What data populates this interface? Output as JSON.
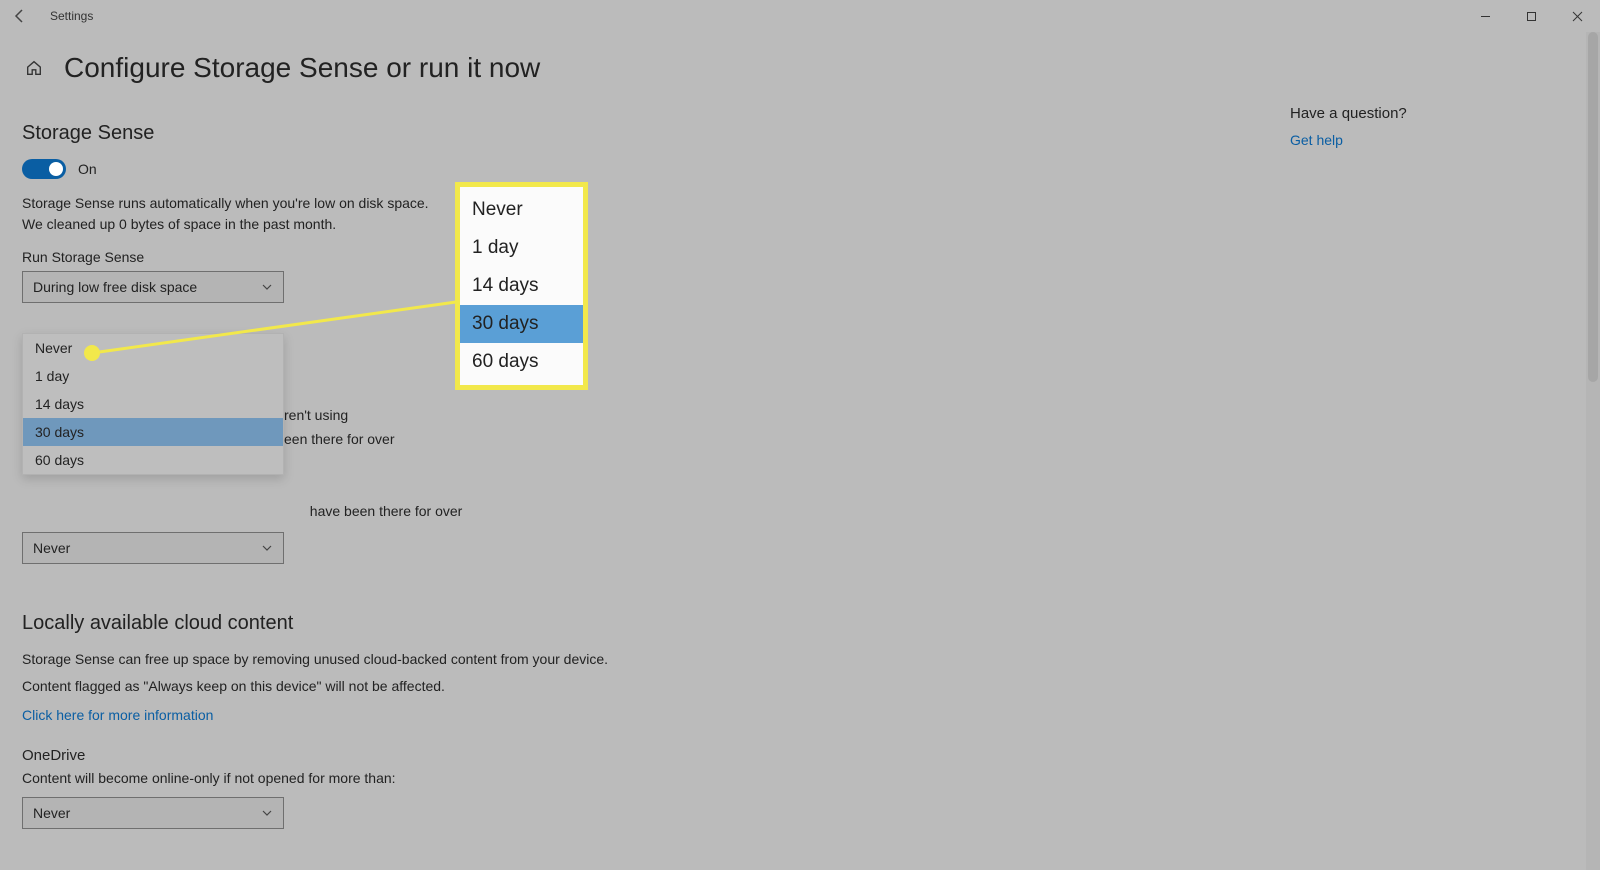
{
  "window": {
    "app_title": "Settings",
    "page_title": "Configure Storage Sense or run it now"
  },
  "storage_sense": {
    "heading": "Storage Sense",
    "toggle_state_label": "On",
    "description_line1": "Storage Sense runs automatically when you're low on disk space.",
    "description_line2": "We cleaned up 0 bytes of space in the past month.",
    "run_label": "Run Storage Sense",
    "run_value": "During low free disk space"
  },
  "temp_files": {
    "partial_right_1": "ren't using",
    "partial_right_2": "een there for over",
    "downloads_label_partial": "have been there for over",
    "downloads_value": "Never"
  },
  "dropdown": {
    "items": [
      "Never",
      "1 day",
      "14 days",
      "30 days",
      "60 days"
    ],
    "selected_index": 3
  },
  "callout": {
    "items": [
      "Never",
      "1 day",
      "14 days",
      "30 days",
      "60 days"
    ],
    "selected_index": 3
  },
  "cloud": {
    "heading": "Locally available cloud content",
    "desc_line1": "Storage Sense can free up space by removing unused cloud-backed content from your device.",
    "desc_line2": "Content flagged as \"Always keep on this device\" will not be affected.",
    "link": "Click here for more information",
    "onedrive_heading": "OneDrive",
    "onedrive_desc": "Content will become online-only if not opened for more than:",
    "onedrive_value": "Never"
  },
  "aside": {
    "question": "Have a question?",
    "help_link": "Get help"
  }
}
